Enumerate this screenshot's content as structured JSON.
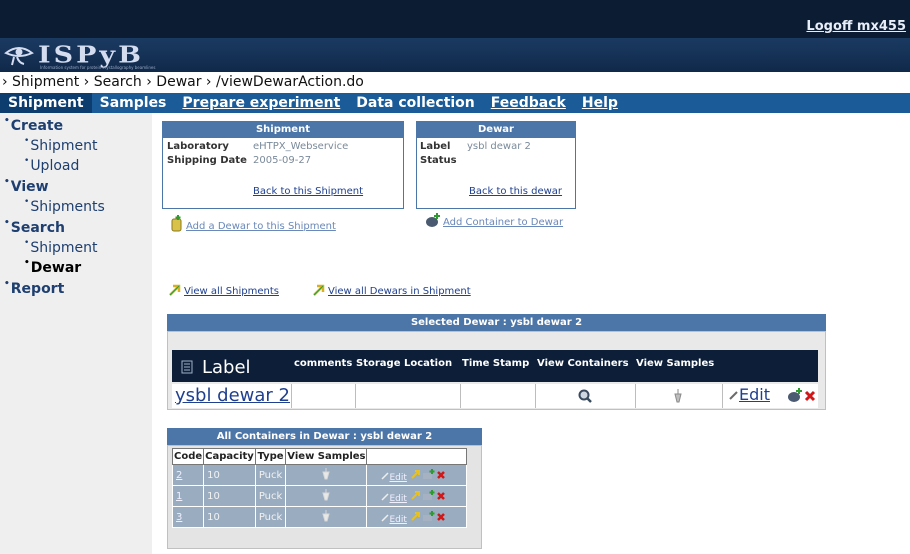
{
  "header": {
    "logoff": "Logoff mx455"
  },
  "logo": {
    "text": "ISPyB",
    "tagline": "Information system for protein crystallography beamlines"
  },
  "breadcrumb": "› Shipment › Search › Dewar › /viewDewarAction.do",
  "menu": [
    {
      "label": "Shipment",
      "active": true
    },
    {
      "label": "Samples"
    },
    {
      "label": "Prepare experiment"
    },
    {
      "label": "Data collection"
    },
    {
      "label": "Feedback"
    },
    {
      "label": "Help"
    }
  ],
  "sidebar": {
    "create": "Create",
    "create_shipment": "Shipment",
    "create_upload": "Upload",
    "view": "View",
    "view_shipments": "Shipments",
    "search": "Search",
    "search_shipment": "Shipment",
    "search_dewar": "Dewar",
    "report": "Report"
  },
  "shipment_box": {
    "title": "Shipment",
    "lab_label": "Laboratory",
    "lab_value": "eHTPX_Webservice",
    "date_label": "Shipping Date",
    "date_value": "2005-09-27",
    "back_link": "Back to this Shipment"
  },
  "dewar_box": {
    "title": "Dewar",
    "label_label": "Label",
    "label_value": "ysbl dewar 2",
    "status_label": "Status",
    "status_value": "",
    "back_link": "Back to this dewar"
  },
  "links": {
    "add_dewar": "Add a Dewar to this Shipment",
    "add_container": "Add Container to Dewar",
    "view_all_shipments": "View all Shipments",
    "view_all_dewars": "View all Dewars in Shipment"
  },
  "selected_dewar": {
    "title": "Selected Dewar : ysbl dewar 2",
    "headers": {
      "label": "Label",
      "comments": "comments",
      "storage": "Storage Location",
      "timestamp": "Time Stamp",
      "view_containers": "View Containers",
      "view_samples": "View Samples"
    },
    "row": {
      "label": "ysbl dewar 2",
      "comments": "",
      "storage": "",
      "timestamp": "",
      "edit": "Edit"
    }
  },
  "containers": {
    "title": "All Containers in Dewar : ysbl dewar 2",
    "headers": {
      "code": "Code",
      "capacity": "Capacity",
      "type": "Type",
      "view_samples": "View Samples"
    },
    "edit_label": "Edit",
    "rows": [
      {
        "code": "2",
        "capacity": "10",
        "type": "Puck"
      },
      {
        "code": "1",
        "capacity": "10",
        "type": "Puck"
      },
      {
        "code": "3",
        "capacity": "10",
        "type": "Puck"
      }
    ]
  },
  "colors": {
    "header_dark": "#0b1c33",
    "menu_blue": "#1a5b98",
    "panel_blue": "#4c76a8",
    "sidebar_bg": "#efefef"
  }
}
